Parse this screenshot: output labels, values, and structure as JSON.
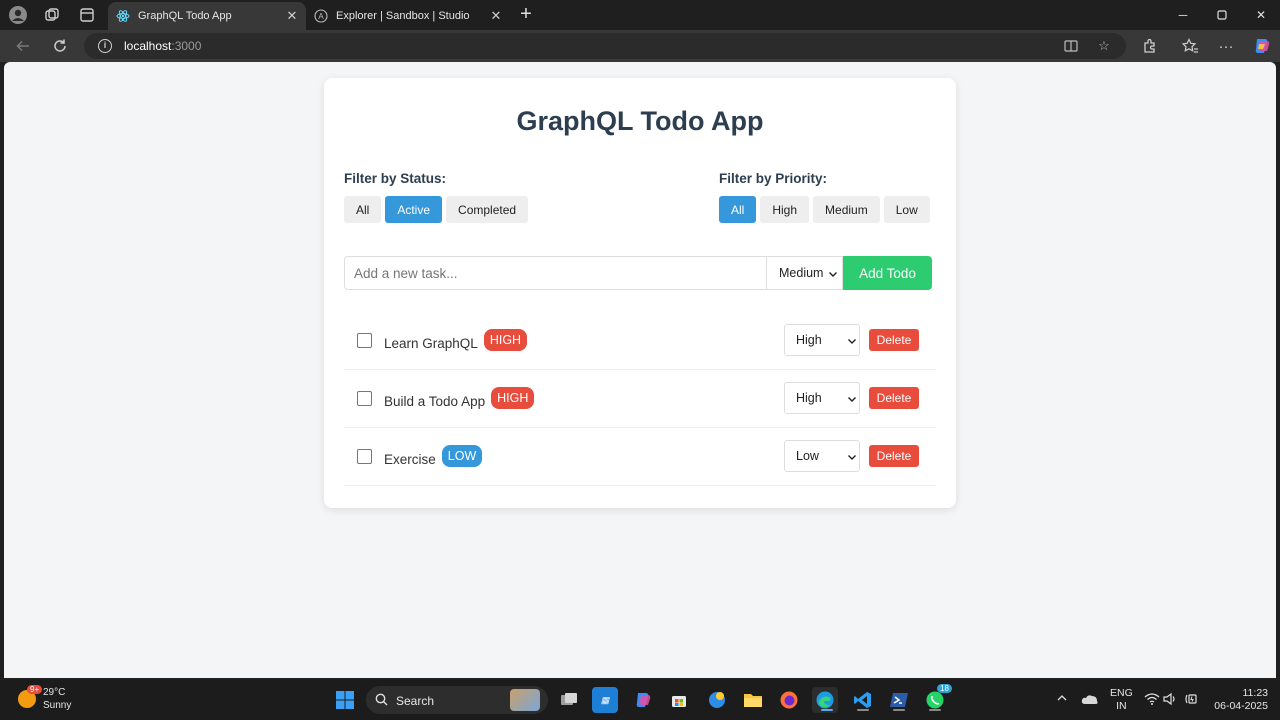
{
  "browser": {
    "tabs": [
      {
        "title": "GraphQL Todo App",
        "active": true,
        "icon": "react-icon"
      },
      {
        "title": "Explorer | Sandbox | Studio",
        "active": false,
        "icon": "apollo-icon"
      }
    ],
    "url_host": "localhost",
    "url_port": ":3000"
  },
  "app": {
    "title": "GraphQL Todo App",
    "status_filter": {
      "label": "Filter by Status:",
      "options": [
        "All",
        "Active",
        "Completed"
      ],
      "selected": "Active"
    },
    "priority_filter": {
      "label": "Filter by Priority:",
      "options": [
        "All",
        "High",
        "Medium",
        "Low"
      ],
      "selected": "All"
    },
    "new_task": {
      "placeholder": "Add a new task...",
      "value": "",
      "priority": "Medium",
      "add_label": "Add Todo"
    },
    "todos": [
      {
        "text": "Learn GraphQL",
        "badge": "HIGH",
        "priority": "High",
        "completed": false,
        "delete_label": "Delete"
      },
      {
        "text": "Build a Todo App",
        "badge": "HIGH",
        "priority": "High",
        "completed": false,
        "delete_label": "Delete"
      },
      {
        "text": "Exercise",
        "badge": "LOW",
        "priority": "Low",
        "completed": false,
        "delete_label": "Delete"
      }
    ]
  },
  "colors": {
    "primary": "#3498db",
    "success": "#2ecc71",
    "danger": "#e74c3c",
    "heading": "#2c3e50"
  },
  "taskbar": {
    "weather_temp": "29°C",
    "weather_desc": "Sunny",
    "weather_badge": "9+",
    "search_label": "Search",
    "whatsapp_badge": "18",
    "lang_1": "ENG",
    "lang_2": "IN",
    "time": "11:23",
    "date": "06-04-2025"
  }
}
